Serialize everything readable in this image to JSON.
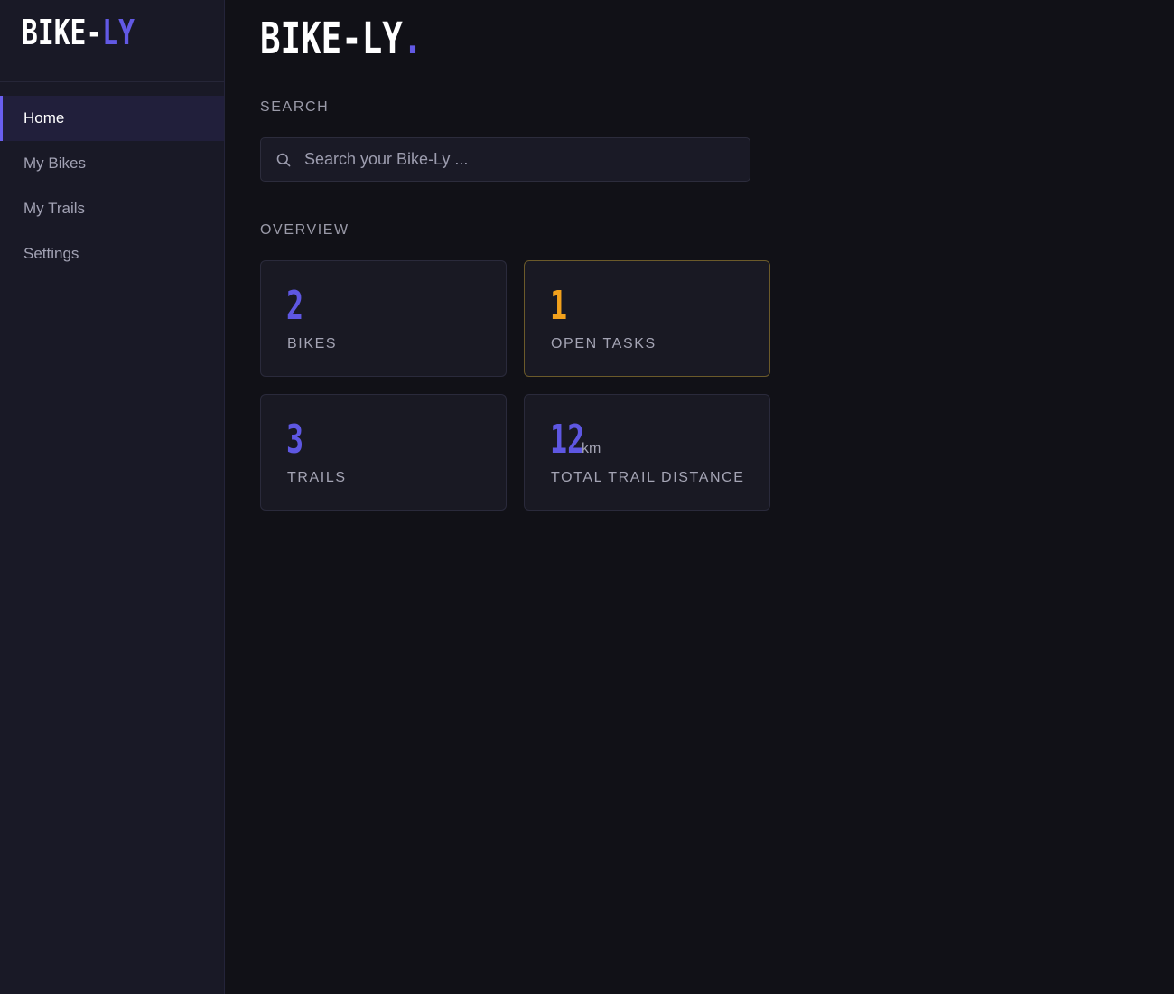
{
  "sidebar": {
    "brand_main": "BIKE-",
    "brand_accent": "LY",
    "items": [
      {
        "label": "Home",
        "active": true
      },
      {
        "label": "My Bikes",
        "active": false
      },
      {
        "label": "My Trails",
        "active": false
      },
      {
        "label": "Settings",
        "active": false
      }
    ]
  },
  "header": {
    "title": "BIKE-LY",
    "title_dot": "."
  },
  "search": {
    "section_label": "SEARCH",
    "placeholder": "Search your Bike-Ly ...",
    "value": "",
    "icon": "search-icon"
  },
  "overview": {
    "section_label": "OVERVIEW",
    "cards": [
      {
        "value": "2",
        "unit": "",
        "label": "BIKES",
        "color": "#5e57e2"
      },
      {
        "value": "1",
        "unit": "",
        "label": "OPEN TASKS",
        "color": "#f2a11c"
      },
      {
        "value": "3",
        "unit": "",
        "label": "TRAILS",
        "color": "#5e57e2"
      },
      {
        "value": "12",
        "unit": "km",
        "label": "TOTAL TRAIL DISTANCE",
        "color": "#5e57e2"
      }
    ]
  },
  "colors": {
    "accent": "#6259e4",
    "warning": "#f2a11c",
    "background": "#111117",
    "sidebar": "#191926"
  }
}
